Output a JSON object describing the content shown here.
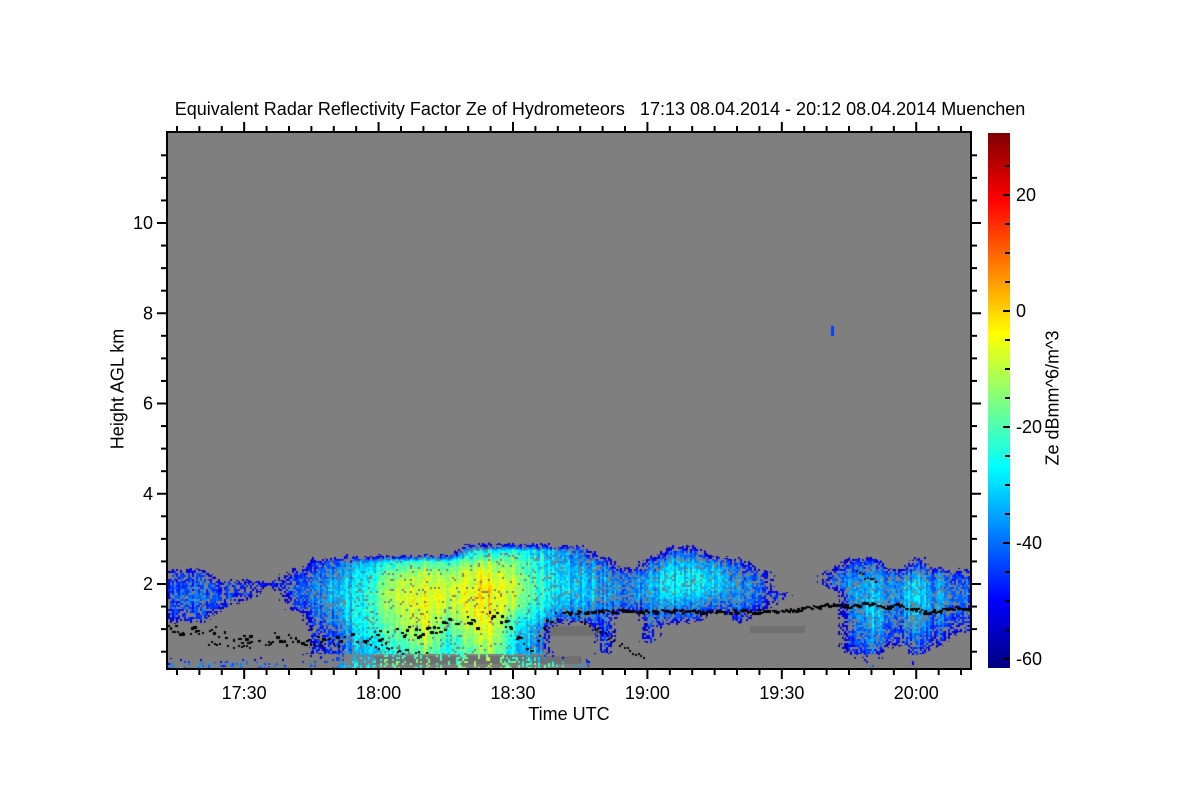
{
  "page": {
    "background": "#ffffff"
  },
  "chart_data": {
    "type": "heatmap",
    "title": "Equivalent Radar Reflectivity Factor Ze of Hydrometeors   17:13 08.04.2014 - 20:12 08.04.2014 Muenchen",
    "station": "Muenchen",
    "time_start": "17:13 08.04.2014",
    "time_end": "20:12 08.04.2014",
    "xlabel": "Time UTC",
    "ylabel": "Height AGL km",
    "x_axis": {
      "start_label": "17:13",
      "end_label": "20:12",
      "span_min": 179,
      "major_ticks": [
        {
          "t": 17,
          "label": "17:30"
        },
        {
          "t": 47,
          "label": "18:00"
        },
        {
          "t": 77,
          "label": "18:30"
        },
        {
          "t": 107,
          "label": "19:00"
        },
        {
          "t": 137,
          "label": "19:30"
        },
        {
          "t": 167,
          "label": "20:00"
        }
      ],
      "minor_first_min": 2,
      "minor_step_min": 5
    },
    "y_axis": {
      "min_km": 0.14,
      "max_km": 12.0,
      "major_ticks": [
        2,
        4,
        6,
        8,
        10
      ],
      "minor_step_km": 0.5
    },
    "colorbar": {
      "label": "Ze dBmm^6/m^3",
      "vmin": -61.5,
      "vmax": 30.5,
      "major_ticks": [
        20,
        0,
        -20,
        -40,
        -60
      ],
      "minor_step": 5,
      "colormap": "jet"
    },
    "colors": {
      "plot_background": "#7f7f7f",
      "shadow_band": "#6f6f6f",
      "dots": "#000000",
      "frame": "#000000",
      "text": "#000000"
    },
    "grid": {
      "comment": "Ze dBZ field; rows bottom-to-top, row centers 0.25..3.0 km step 0.25; cols 5-min bins from 17:13; -99 = no echo (gray)",
      "t0_min": 2.5,
      "dt_min": 5,
      "h0_km": 0.25,
      "dh_km": 0.25,
      "values": [
        [
          -38,
          -38,
          -40,
          -40,
          -42,
          -40,
          -38,
          -36,
          -30,
          -20,
          -18,
          -16,
          -20,
          -16,
          -14,
          -18,
          -22,
          -26,
          -34,
          -99,
          -99,
          -99,
          -99,
          -99,
          -99,
          -99,
          -99,
          -99,
          -99,
          -99,
          -99,
          -46,
          -99,
          -48,
          -99,
          -99
        ],
        [
          -99,
          -99,
          -99,
          -99,
          -99,
          -99,
          -50,
          -46,
          -34,
          -27,
          -24,
          -14,
          -28,
          -18,
          -12,
          -32,
          -36,
          -99,
          -99,
          -48,
          -99,
          -99,
          -99,
          -99,
          -99,
          -99,
          -99,
          -99,
          -99,
          -99,
          -48,
          -42,
          -99,
          -45,
          -99,
          -99
        ],
        [
          -99,
          -99,
          -99,
          -99,
          -99,
          -99,
          -48,
          -44,
          -31,
          -24,
          -19,
          -9,
          -27,
          -14,
          -9,
          -29,
          -38,
          -99,
          -99,
          -46,
          -99,
          -48,
          -99,
          -99,
          -99,
          -99,
          -99,
          -99,
          -99,
          -99,
          -45,
          -38,
          -48,
          -42,
          -48,
          -99
        ],
        [
          -99,
          -99,
          -99,
          -99,
          -99,
          -99,
          -47,
          -41,
          -29,
          -21,
          -14,
          -7,
          -24,
          -9,
          -7,
          -27,
          -36,
          -99,
          -99,
          -44,
          -99,
          -45,
          -99,
          -99,
          -99,
          -99,
          -99,
          -99,
          -99,
          -99,
          -42,
          -35,
          -45,
          -38,
          -45,
          -48
        ],
        [
          -47,
          -45,
          -99,
          -99,
          -99,
          -99,
          -42,
          -37,
          -27,
          -19,
          -11,
          -5,
          -19,
          -7,
          -5,
          -21,
          -31,
          -41,
          -40,
          -42,
          -99,
          -42,
          -44,
          -44,
          -99,
          -45,
          -99,
          -99,
          -99,
          -99,
          -40,
          -32,
          -42,
          -35,
          -42,
          -45
        ],
        [
          -45,
          -42,
          -47,
          -99,
          -99,
          -47,
          -40,
          -34,
          -27,
          -17,
          -9,
          -4,
          -14,
          -5,
          -4,
          -14,
          -27,
          -34,
          -35,
          -38,
          -42,
          -38,
          -38,
          -39,
          -42,
          -40,
          -47,
          -99,
          -99,
          -99,
          -38,
          -32,
          -40,
          -32,
          -38,
          -42
        ],
        [
          -42,
          -40,
          -44,
          -49,
          -99,
          -44,
          -38,
          -32,
          -27,
          -15,
          -7,
          -4,
          -11,
          -4,
          -3,
          -11,
          -24,
          -31,
          -33,
          -36,
          -40,
          -34,
          -31,
          -32,
          -35,
          -38,
          -44,
          -49,
          -99,
          -99,
          -36,
          -33,
          -38,
          -30,
          -36,
          -40
        ],
        [
          -44,
          -42,
          -46,
          -48,
          -50,
          -44,
          -38,
          -33,
          -28,
          -17,
          -9,
          -6,
          -13,
          -5,
          -4,
          -9,
          -23,
          -29,
          -32,
          -36,
          -40,
          -33,
          -27,
          -27,
          -30,
          -36,
          -43,
          -99,
          -99,
          -46,
          -36,
          -34,
          -38,
          -32,
          -38,
          -42
        ],
        [
          -48,
          -46,
          -99,
          -99,
          -99,
          -48,
          -42,
          -36,
          -30,
          -21,
          -14,
          -9,
          -17,
          -7,
          -7,
          -13,
          -25,
          -30,
          -34,
          -38,
          -44,
          -37,
          -29,
          -29,
          -32,
          -39,
          -47,
          -99,
          -99,
          -48,
          -40,
          -38,
          -43,
          -38,
          -43,
          -46
        ],
        [
          -99,
          -99,
          -99,
          -99,
          -99,
          -99,
          -48,
          -42,
          -35,
          -27,
          -23,
          -18,
          -25,
          -15,
          -13,
          -17,
          -27,
          -32,
          -38,
          -44,
          -99,
          -43,
          -35,
          -35,
          -38,
          -45,
          -99,
          -99,
          -99,
          -99,
          -45,
          -43,
          -99,
          -45,
          -99,
          -99
        ],
        [
          -99,
          -99,
          -99,
          -99,
          -99,
          -99,
          -99,
          -99,
          -99,
          -99,
          -99,
          -99,
          -99,
          -29,
          -27,
          -25,
          -31,
          -35,
          -43,
          -99,
          -99,
          -99,
          -45,
          -43,
          -99,
          -99,
          -99,
          -99,
          -99,
          -99,
          -99,
          -99,
          -99,
          -99,
          -99,
          -99
        ],
        [
          -99,
          -99,
          -99,
          -99,
          -99,
          -99,
          -99,
          -99,
          -99,
          -99,
          -99,
          -99,
          -99,
          -99,
          -99,
          -99,
          -99,
          -99,
          -99,
          -99,
          -99,
          -99,
          -99,
          -99,
          -99,
          -99,
          -99,
          -99,
          -99,
          -99,
          -99,
          -99,
          -99,
          -99,
          -99,
          -99
        ]
      ]
    },
    "melting_layer_track": [
      [
        0,
        1.03
      ],
      [
        3,
        1.0
      ],
      [
        6,
        0.97
      ],
      [
        9,
        0.92
      ],
      [
        12,
        0.86
      ],
      [
        15,
        0.8
      ],
      [
        18,
        0.78
      ],
      [
        21,
        0.8
      ],
      [
        24,
        0.78
      ],
      [
        27,
        0.76
      ],
      [
        30,
        0.78
      ],
      [
        33,
        0.76
      ],
      [
        36,
        0.74
      ],
      [
        39,
        0.78
      ],
      [
        42,
        0.82
      ],
      [
        45,
        0.88
      ],
      [
        48,
        0.84
      ],
      [
        51,
        0.9
      ],
      [
        54,
        0.98
      ],
      [
        57,
        0.92
      ],
      [
        60,
        1.05
      ],
      [
        63,
        1.15
      ],
      [
        66,
        1.1
      ],
      [
        69,
        1.18
      ],
      [
        72,
        1.28
      ],
      [
        74,
        1.3
      ],
      [
        77,
        1.0
      ],
      [
        79,
        0.7
      ],
      [
        81,
        0.52
      ],
      [
        83,
        0.9
      ],
      [
        85,
        1.25
      ],
      [
        88,
        1.36
      ],
      [
        92,
        1.4
      ],
      [
        96,
        1.42
      ],
      [
        100,
        1.41
      ],
      [
        105,
        1.4
      ],
      [
        110,
        1.42
      ],
      [
        115,
        1.41
      ],
      [
        120,
        1.4
      ],
      [
        125,
        1.41
      ],
      [
        130,
        1.42
      ],
      [
        135,
        1.4
      ],
      [
        140,
        1.44
      ],
      [
        144,
        1.5
      ],
      [
        148,
        1.55
      ],
      [
        152,
        1.52
      ],
      [
        156,
        1.6
      ],
      [
        160,
        1.5
      ],
      [
        163,
        1.55
      ],
      [
        166,
        1.45
      ],
      [
        169,
        1.4
      ],
      [
        172,
        1.42
      ],
      [
        175,
        1.48
      ],
      [
        179,
        1.47
      ]
    ],
    "melting_layer_dotted_before_min": 88,
    "scatter_segments": [
      {
        "t0": 9,
        "t1": 19,
        "h0": 0.72,
        "h1": 0.6
      },
      {
        "t0": 45,
        "t1": 58,
        "h0": 0.62,
        "h1": 0.45
      },
      {
        "t0": 91,
        "t1": 106,
        "h0": 1.3,
        "h1": 0.35
      },
      {
        "t0": 153,
        "t1": 158,
        "h0": 2.3,
        "h1": 2.05
      }
    ],
    "isolated_echo": {
      "t_min": 148,
      "height_km": 7.6,
      "value_dbz": -44
    },
    "shadow_bands": [
      {
        "t0": 46,
        "t1": 92,
        "h0": 0.26,
        "h1": 0.4
      },
      {
        "t0": 84,
        "t1": 97,
        "h0": 0.88,
        "h1": 1.06
      },
      {
        "t0": 130,
        "t1": 142,
        "h0": 0.93,
        "h1": 1.07
      }
    ]
  }
}
